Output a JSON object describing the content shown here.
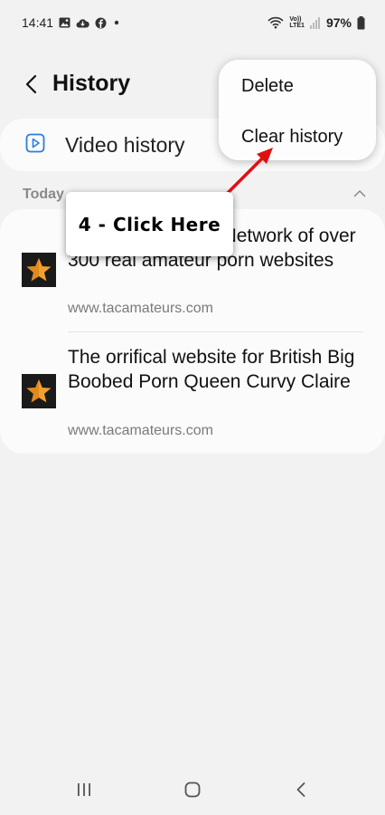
{
  "status_bar": {
    "time": "14:41",
    "notification_icons": [
      "image-icon",
      "cloud-icon",
      "facebook-icon",
      "dot-icon"
    ],
    "network_label_top": "Vo))",
    "network_label_bottom": "LTE1",
    "battery": "97%"
  },
  "header": {
    "title": "History",
    "back_icon": "chevron-left-icon"
  },
  "video_history": {
    "label": "Video history",
    "icon": "play-square-icon"
  },
  "section": {
    "label": "Today",
    "collapse_icon": "chevron-up-icon"
  },
  "history_items": [
    {
      "title": "The best Amateur Network of over 300 real amateur porn websites",
      "url": "www.tacamateurs.com",
      "icon": "star-favicon"
    },
    {
      "title": "The orrifical website for British Big Boobed Porn Queen Curvy Claire",
      "url": "www.tacamateurs.com",
      "icon": "star-favicon"
    }
  ],
  "menu": {
    "delete": "Delete",
    "clear_history": "Clear history"
  },
  "callout": {
    "text": "4 - Click Here"
  },
  "colors": {
    "background": "#f2f2f2",
    "card": "#fbfbfb",
    "accent_blue": "#2a7de1",
    "star_orange": "#f0a030",
    "arrow_red": "#e01010"
  },
  "nav_bar": {
    "recent_icon": "recent-apps-icon",
    "home_icon": "home-icon",
    "back_icon": "back-icon"
  }
}
